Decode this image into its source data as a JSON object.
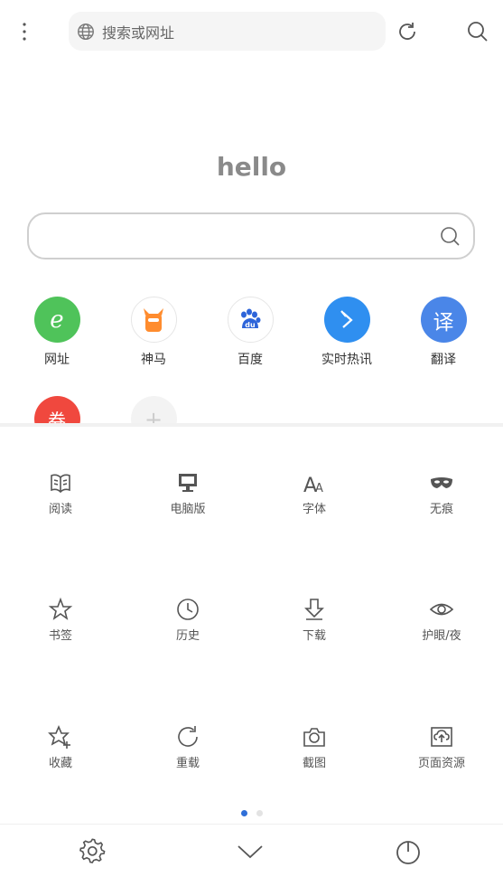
{
  "topbar": {
    "url_placeholder": "搜索或网址",
    "menu_icon": "more-vertical-icon",
    "globe_icon": "globe-icon",
    "refresh_icon": "refresh-icon",
    "search_icon": "search-icon"
  },
  "home": {
    "title": "hello",
    "search_placeholder": ""
  },
  "shortcuts": [
    {
      "label": "网址",
      "icon": "e-logo-icon",
      "color": "#4fc35a"
    },
    {
      "label": "神马",
      "icon": "shenma-logo-icon",
      "color": "#ff8c2e"
    },
    {
      "label": "百度",
      "icon": "baidu-paw-icon",
      "color": "#2d64d9"
    },
    {
      "label": "实时热讯",
      "icon": "arrow-news-icon",
      "color": "#2f8ff0"
    },
    {
      "label": "翻译",
      "icon": "translate-icon",
      "color": "#4a86e8",
      "glyph": "译"
    },
    {
      "label": "",
      "icon": "coupon-icon",
      "color": "#f0483e",
      "glyph": "券"
    },
    {
      "label": "",
      "icon": "add-icon",
      "color": "#f0f0f0",
      "glyph": "+"
    }
  ],
  "menu": {
    "row1": [
      "阅读",
      "电脑版",
      "字体",
      "无痕"
    ],
    "row2": [
      "书签",
      "历史",
      "下载",
      "护眼/夜"
    ],
    "row3": [
      "收藏",
      "重载",
      "截图",
      "页面资源"
    ]
  },
  "pager": {
    "pages": 2,
    "active": 1
  },
  "bottom": {
    "settings_icon": "gear-icon",
    "collapse_icon": "chevron-down-icon",
    "power_icon": "power-icon"
  },
  "colors": {
    "accent": "#2f6fd8",
    "icon_gray": "#555555"
  }
}
